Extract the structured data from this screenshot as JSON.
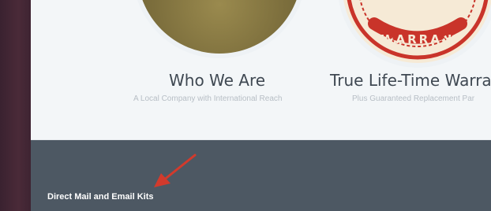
{
  "features": [
    {
      "title": "Who We Are",
      "subtitle": "A Local Company with International Reach",
      "icon": "grass-photo"
    },
    {
      "title": "True Life-Time Warra",
      "subtitle": "Plus Guaranteed Replacement Par",
      "icon": "warranty-seal",
      "seal_text": "WARRAN"
    }
  ],
  "footer": {
    "link_label": "Direct Mail and Email Kits"
  },
  "annotation": {
    "type": "red-arrow",
    "color": "#d23a2c"
  },
  "colors": {
    "footer_bg": "#4d5863",
    "content_bg": "#f3f6f8",
    "seal_red": "#c9342a"
  }
}
